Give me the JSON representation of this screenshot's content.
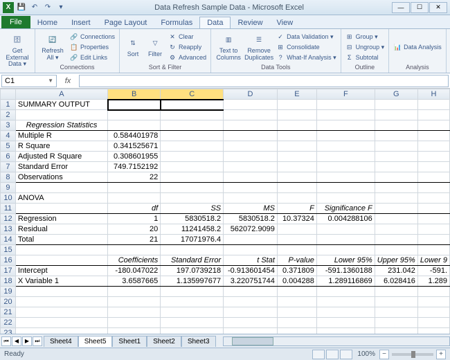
{
  "title": "Data Refresh Sample Data - Microsoft Excel",
  "qat": {
    "excel_icon": "X",
    "save": "💾",
    "undo": "↶",
    "redo": "↷",
    "dropdown": "▾"
  },
  "win": {
    "min": "—",
    "max": "☐",
    "close": "✕",
    "help": "?"
  },
  "tabs": [
    "File",
    "Home",
    "Insert",
    "Page Layout",
    "Formulas",
    "Data",
    "Review",
    "View"
  ],
  "active_tab": "Data",
  "ribbon": {
    "ext": {
      "get_external": "Get External\nData ▾",
      "label": ""
    },
    "conn": {
      "refresh": "Refresh\nAll ▾",
      "connections": "Connections",
      "properties": "Properties",
      "edit_links": "Edit Links",
      "label": "Connections"
    },
    "sort": {
      "sort": "Sort",
      "filter": "Filter",
      "clear": "Clear",
      "reapply": "Reapply",
      "advanced": "Advanced",
      "label": "Sort & Filter"
    },
    "tools": {
      "text_to_cols": "Text to\nColumns",
      "remove_dup": "Remove\nDuplicates",
      "validation": "Data Validation ▾",
      "consolidate": "Consolidate",
      "whatif": "What-If Analysis ▾",
      "label": "Data Tools"
    },
    "outline": {
      "group": "Group ▾",
      "ungroup": "Ungroup ▾",
      "subtotal": "Subtotal",
      "label": "Outline"
    },
    "analysis": {
      "data_analysis": "Data Analysis",
      "label": "Analysis"
    }
  },
  "namebox": "C1",
  "fx": "fx",
  "cols": [
    "A",
    "B",
    "C",
    "D",
    "E",
    "F",
    "G",
    "H"
  ],
  "rows": {
    "1": {
      "A": "SUMMARY OUTPUT"
    },
    "3": {
      "A": "Regression Statistics"
    },
    "4": {
      "A": "Multiple R",
      "B": "0.584401978"
    },
    "5": {
      "A": "R Square",
      "B": "0.341525671"
    },
    "6": {
      "A": "Adjusted R Square",
      "B": "0.308601955"
    },
    "7": {
      "A": "Standard Error",
      "B": "749.7152192"
    },
    "8": {
      "A": "Observations",
      "B": "22"
    },
    "10": {
      "A": "ANOVA"
    },
    "11": {
      "B": "df",
      "C": "SS",
      "D": "MS",
      "E": "F",
      "F": "Significance F"
    },
    "12": {
      "A": "Regression",
      "B": "1",
      "C": "5830518.2",
      "D": "5830518.2",
      "E": "10.37324",
      "F": "0.004288106"
    },
    "13": {
      "A": "Residual",
      "B": "20",
      "C": "11241458.2",
      "D": "562072.9099"
    },
    "14": {
      "A": "Total",
      "B": "21",
      "C": "17071976.4"
    },
    "16": {
      "B": "Coefficients",
      "C": "Standard Error",
      "D": "t Stat",
      "E": "P-value",
      "F": "Lower 95%",
      "G": "Upper 95%",
      "H": "Lower 9"
    },
    "17": {
      "A": "Intercept",
      "B": "-180.047022",
      "C": "197.0739218",
      "D": "-0.913601454",
      "E": "0.371809",
      "F": "-591.1360188",
      "G": "231.042",
      "H": "-591."
    },
    "18": {
      "A": "X Variable 1",
      "B": "3.6587665",
      "C": "1.135997677",
      "D": "3.220751744",
      "E": "0.004288",
      "F": "1.289116869",
      "G": "6.028416",
      "H": "1.289"
    }
  },
  "sheets": [
    "Sheet4",
    "Sheet5",
    "Sheet1",
    "Sheet2",
    "Sheet3"
  ],
  "active_sheet": "Sheet5",
  "status": "Ready",
  "zoom": "100%"
}
